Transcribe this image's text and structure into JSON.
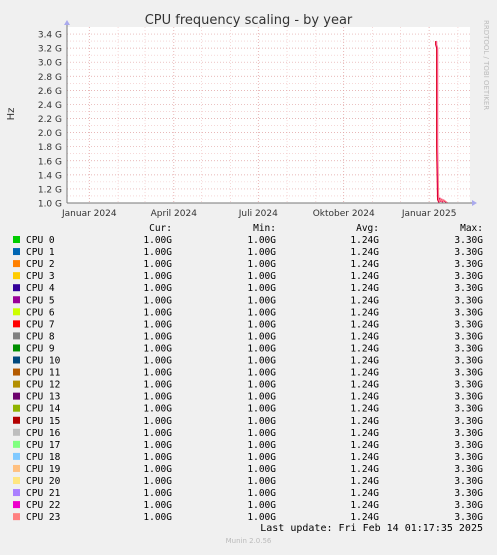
{
  "chart_data": {
    "type": "line",
    "title": "CPU frequency scaling - by year",
    "ylabel": "Hz",
    "watermark": "RRDTOOL / TOBI OETIKER",
    "y_ticks": [
      "1.0 G",
      "1.2 G",
      "1.4 G",
      "1.6 G",
      "1.8 G",
      "2.0 G",
      "2.2 G",
      "2.4 G",
      "2.6 G",
      "2.8 G",
      "3.0 G",
      "3.2 G",
      "3.4 G"
    ],
    "y_tick_values": [
      1.0,
      1.2,
      1.4,
      1.6,
      1.8,
      2.0,
      2.2,
      2.4,
      2.6,
      2.8,
      3.0,
      3.2,
      3.4
    ],
    "ylim": [
      1.0,
      3.5
    ],
    "x_ticks": [
      "Januar 2024",
      "April 2024",
      "Juli 2024",
      "Oktober 2024",
      "Januar 2025"
    ],
    "x_tick_dates": [
      "2024-01-01",
      "2024-04-01",
      "2024-07-01",
      "2024-10-01",
      "2025-01-01"
    ],
    "xlim": [
      "2023-12-08",
      "2025-02-14"
    ],
    "grid": true,
    "series_line": {
      "x": [
        "2025-01-08",
        "2025-01-08",
        "2025-01-09",
        "2025-01-09",
        "2025-01-10",
        "2025-01-11",
        "2025-01-12",
        "2025-01-13",
        "2025-01-14",
        "2025-01-15",
        "2025-01-16",
        "2025-01-18",
        "2025-01-20"
      ],
      "values": [
        3.3,
        3.25,
        3.2,
        1.8,
        1.05,
        1.02,
        1.06,
        1.03,
        1.05,
        1.02,
        1.04,
        1.02,
        1.0
      ]
    },
    "legend_headers": {
      "cur": "Cur:",
      "min": "Min:",
      "avg": "Avg:",
      "max": "Max:"
    },
    "series": [
      {
        "name": "CPU 0",
        "color": "#00cc00",
        "cur": "1.00G",
        "min": "1.00G",
        "avg": "1.24G",
        "max": "3.30G"
      },
      {
        "name": "CPU 1",
        "color": "#0066b3",
        "cur": "1.00G",
        "min": "1.00G",
        "avg": "1.24G",
        "max": "3.30G"
      },
      {
        "name": "CPU 2",
        "color": "#ff8000",
        "cur": "1.00G",
        "min": "1.00G",
        "avg": "1.24G",
        "max": "3.30G"
      },
      {
        "name": "CPU 3",
        "color": "#ffcc00",
        "cur": "1.00G",
        "min": "1.00G",
        "avg": "1.24G",
        "max": "3.30G"
      },
      {
        "name": "CPU 4",
        "color": "#330099",
        "cur": "1.00G",
        "min": "1.00G",
        "avg": "1.24G",
        "max": "3.30G"
      },
      {
        "name": "CPU 5",
        "color": "#990099",
        "cur": "1.00G",
        "min": "1.00G",
        "avg": "1.24G",
        "max": "3.30G"
      },
      {
        "name": "CPU 6",
        "color": "#ccff00",
        "cur": "1.00G",
        "min": "1.00G",
        "avg": "1.24G",
        "max": "3.30G"
      },
      {
        "name": "CPU 7",
        "color": "#ff0000",
        "cur": "1.00G",
        "min": "1.00G",
        "avg": "1.24G",
        "max": "3.30G"
      },
      {
        "name": "CPU 8",
        "color": "#808080",
        "cur": "1.00G",
        "min": "1.00G",
        "avg": "1.24G",
        "max": "3.30G"
      },
      {
        "name": "CPU 9",
        "color": "#008f00",
        "cur": "1.00G",
        "min": "1.00G",
        "avg": "1.24G",
        "max": "3.30G"
      },
      {
        "name": "CPU 10",
        "color": "#00487d",
        "cur": "1.00G",
        "min": "1.00G",
        "avg": "1.24G",
        "max": "3.30G"
      },
      {
        "name": "CPU 11",
        "color": "#b35a00",
        "cur": "1.00G",
        "min": "1.00G",
        "avg": "1.24G",
        "max": "3.30G"
      },
      {
        "name": "CPU 12",
        "color": "#b38f00",
        "cur": "1.00G",
        "min": "1.00G",
        "avg": "1.24G",
        "max": "3.30G"
      },
      {
        "name": "CPU 13",
        "color": "#6b006b",
        "cur": "1.00G",
        "min": "1.00G",
        "avg": "1.24G",
        "max": "3.30G"
      },
      {
        "name": "CPU 14",
        "color": "#8fb300",
        "cur": "1.00G",
        "min": "1.00G",
        "avg": "1.24G",
        "max": "3.30G"
      },
      {
        "name": "CPU 15",
        "color": "#b30000",
        "cur": "1.00G",
        "min": "1.00G",
        "avg": "1.24G",
        "max": "3.30G"
      },
      {
        "name": "CPU 16",
        "color": "#bebebe",
        "cur": "1.00G",
        "min": "1.00G",
        "avg": "1.24G",
        "max": "3.30G"
      },
      {
        "name": "CPU 17",
        "color": "#80ff80",
        "cur": "1.00G",
        "min": "1.00G",
        "avg": "1.24G",
        "max": "3.30G"
      },
      {
        "name": "CPU 18",
        "color": "#80c9ff",
        "cur": "1.00G",
        "min": "1.00G",
        "avg": "1.24G",
        "max": "3.30G"
      },
      {
        "name": "CPU 19",
        "color": "#ffc080",
        "cur": "1.00G",
        "min": "1.00G",
        "avg": "1.24G",
        "max": "3.30G"
      },
      {
        "name": "CPU 20",
        "color": "#ffe680",
        "cur": "1.00G",
        "min": "1.00G",
        "avg": "1.24G",
        "max": "3.30G"
      },
      {
        "name": "CPU 21",
        "color": "#aa80ff",
        "cur": "1.00G",
        "min": "1.00G",
        "avg": "1.24G",
        "max": "3.30G"
      },
      {
        "name": "CPU 22",
        "color": "#ee00cc",
        "cur": "1.00G",
        "min": "1.00G",
        "avg": "1.24G",
        "max": "3.30G"
      },
      {
        "name": "CPU 23",
        "color": "#ff8080",
        "cur": "1.00G",
        "min": "1.00G",
        "avg": "1.24G",
        "max": "3.30G"
      }
    ],
    "last_update": "Last update: Fri Feb 14 01:17:35 2025",
    "footer": "Munin 2.0.56"
  }
}
